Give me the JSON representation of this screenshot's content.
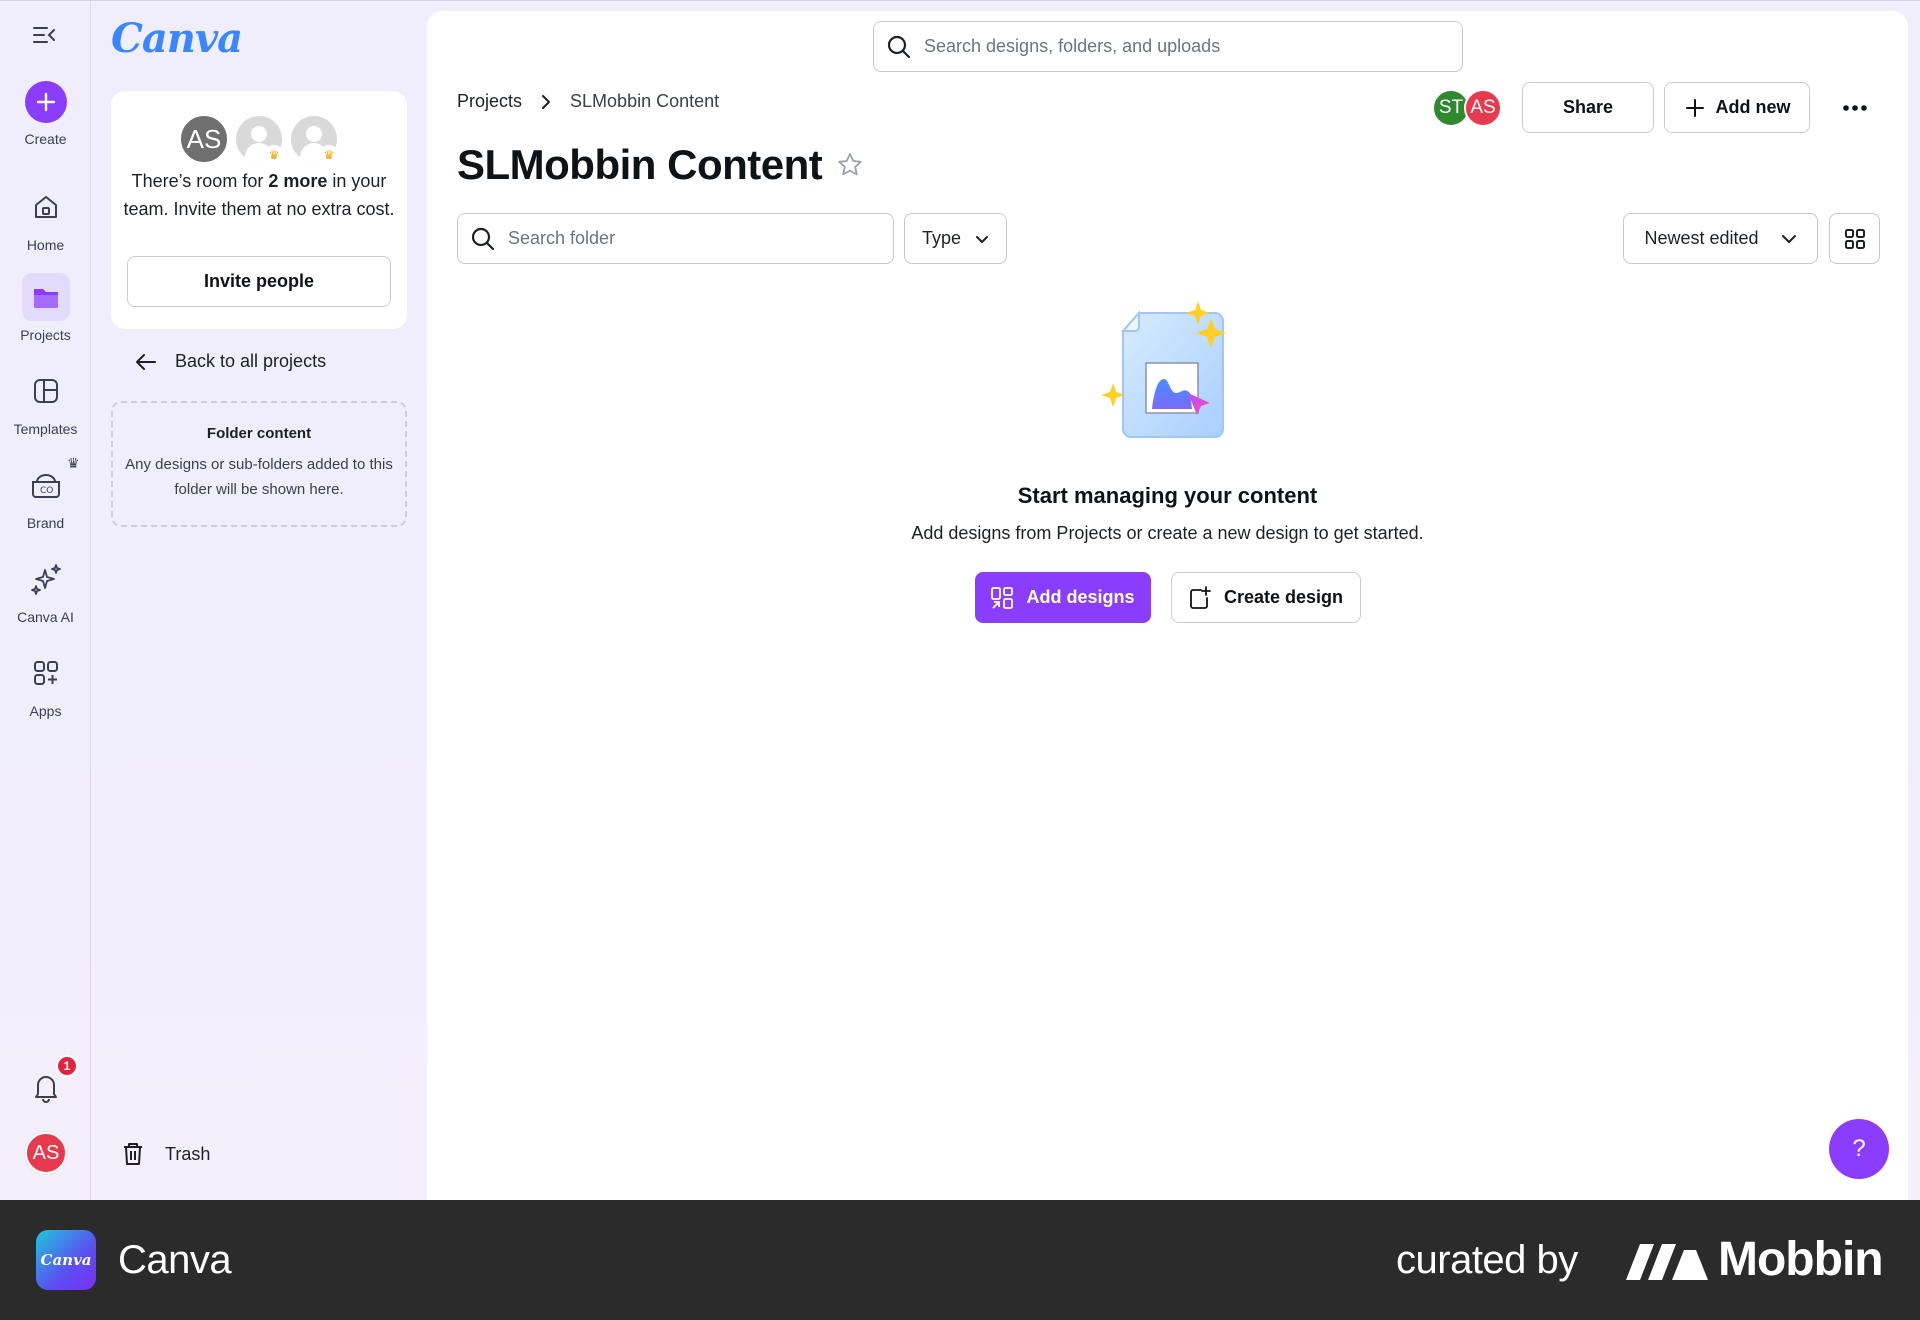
{
  "rail": {
    "create": "Create",
    "home": "Home",
    "projects": "Projects",
    "templates": "Templates",
    "brand": "Brand",
    "canva_ai": "Canva AI",
    "apps": "Apps",
    "notification_count": "1",
    "avatar_initials": "AS"
  },
  "panel": {
    "logo": "Canva",
    "team": {
      "avatar_initials": "AS",
      "text_before": "There’s room for ",
      "text_bold": "2 more",
      "text_after": " in your team. Invite them at no extra cost.",
      "invite_label": "Invite people"
    },
    "back_label": "Back to all projects",
    "folder": {
      "title": "Folder content",
      "description": "Any designs or sub-folders added to this folder will be shown here."
    },
    "trash_label": "Trash"
  },
  "main": {
    "search_placeholder": "Search designs, folders, and uploads",
    "breadcrumb": {
      "root": "Projects",
      "current": "SLMobbin Content"
    },
    "title": "SLMobbin Content",
    "collaborators": [
      "ST",
      "AS"
    ],
    "share_label": "Share",
    "add_new_label": "Add new",
    "folder_search_placeholder": "Search folder",
    "type_label": "Type",
    "sort_label": "Newest edited",
    "empty": {
      "title": "Start managing your content",
      "subtitle": "Add designs from Projects or create a new design to get started.",
      "add_designs_label": "Add designs",
      "create_design_label": "Create design"
    },
    "help_label": "?"
  },
  "footer": {
    "app_name": "Canva",
    "app_icon_text": "Canva",
    "curated_by": "curated by",
    "brand": "Mobbin"
  },
  "colors": {
    "accent": "#8b3dff",
    "notification": "#e0243e",
    "avatar_as": "#e83a4f",
    "avatar_st": "#2f8a2f"
  }
}
